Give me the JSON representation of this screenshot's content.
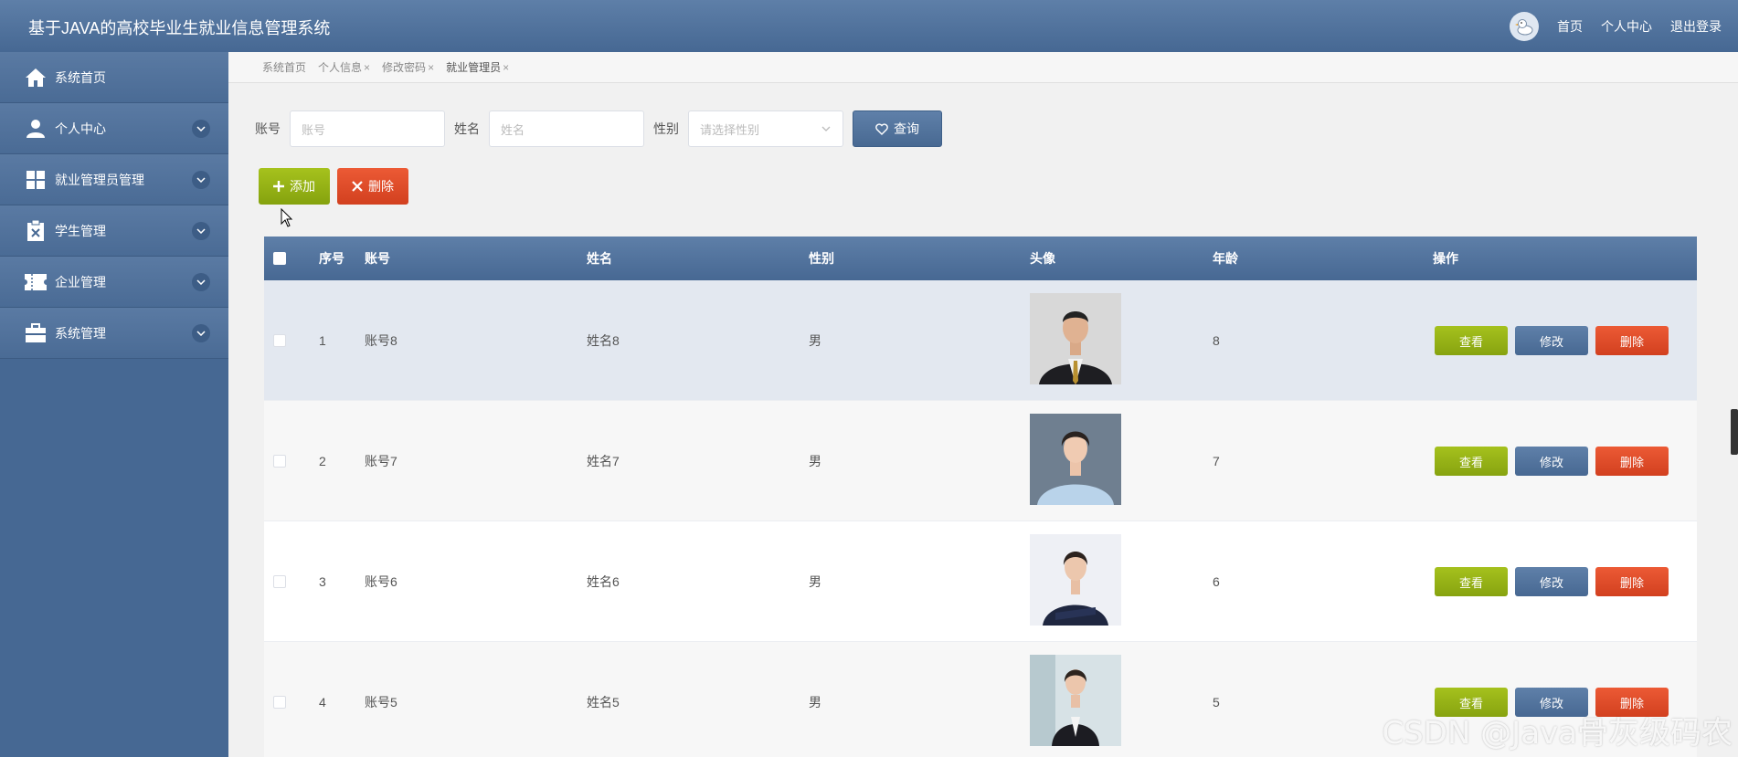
{
  "app": {
    "title": "基于JAVA的高校毕业生就业信息管理系统"
  },
  "header": {
    "links": [
      "首页",
      "个人中心",
      "退出登录"
    ]
  },
  "sidebar": {
    "items": [
      {
        "label": "系统首页",
        "icon": "home-icon"
      },
      {
        "label": "个人中心",
        "icon": "user-icon"
      },
      {
        "label": "就业管理员管理",
        "icon": "grid-icon"
      },
      {
        "label": "学生管理",
        "icon": "clipboard-icon"
      },
      {
        "label": "企业管理",
        "icon": "ticket-icon"
      },
      {
        "label": "系统管理",
        "icon": "briefcase-icon"
      }
    ]
  },
  "tabs": [
    {
      "label": "系统首页"
    },
    {
      "label": "个人信息",
      "close": "×"
    },
    {
      "label": "修改密码",
      "close": "×"
    },
    {
      "label": "就业管理员",
      "close": "×"
    }
  ],
  "search": {
    "account_label": "账号",
    "account_placeholder": "账号",
    "name_label": "姓名",
    "name_placeholder": "姓名",
    "gender_label": "性别",
    "gender_placeholder": "请选择性别",
    "query_label": "查询"
  },
  "actions": {
    "add_label": "添加",
    "delete_label": "删除"
  },
  "table": {
    "columns": [
      "序号",
      "账号",
      "姓名",
      "性别",
      "头像",
      "年龄",
      "操作"
    ],
    "rows": [
      {
        "index": "1",
        "account": "账号8",
        "name": "姓名8",
        "gender": "男",
        "age": "8"
      },
      {
        "index": "2",
        "account": "账号7",
        "name": "姓名7",
        "gender": "男",
        "age": "7"
      },
      {
        "index": "3",
        "account": "账号6",
        "name": "姓名6",
        "gender": "男",
        "age": "6"
      },
      {
        "index": "4",
        "account": "账号5",
        "name": "姓名5",
        "gender": "男",
        "age": "5"
      }
    ],
    "op_labels": {
      "view": "查看",
      "edit": "修改",
      "delete": "删除"
    }
  },
  "watermark": "CSDN @Java骨灰级码农",
  "colors": {
    "header": "#466893",
    "green": "#8aa512",
    "red": "#d9452a",
    "blue": "#4f7099",
    "highlight_row": "#e3e8f0"
  }
}
